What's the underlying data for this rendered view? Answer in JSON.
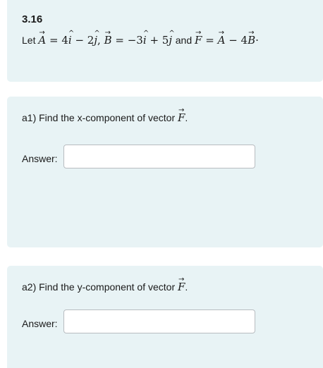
{
  "problem": {
    "title": "3.16",
    "prompt": {
      "let": "Let",
      "a_def_lhs": "A",
      "a_def_rhs_1": "= 4",
      "a_def_rhs_2": "− 2",
      "b_def_lhs": "B",
      "b_def_rhs_1": "= −3",
      "b_def_rhs_2": "+ 5",
      "and": "and",
      "f_def_lhs": "F",
      "f_def_rhs_1": "=",
      "f_def_rhs_2": "− 4",
      "i_hat": "i",
      "j_hat": "j",
      "arrow": "→",
      "hat": "^",
      "comma": ",",
      "period": "·"
    }
  },
  "parts": [
    {
      "question_prefix": "a1) Find the x-component of vector",
      "vector": "F",
      "suffix": ".",
      "answer_label": "Answer:",
      "answer_value": ""
    },
    {
      "question_prefix": "a2) Find the y-component of vector",
      "vector": "F",
      "suffix": ".",
      "answer_label": "Answer:",
      "answer_value": ""
    }
  ],
  "colors": {
    "card_background": "#e8f3f5",
    "input_border": "#b8bcc0"
  }
}
